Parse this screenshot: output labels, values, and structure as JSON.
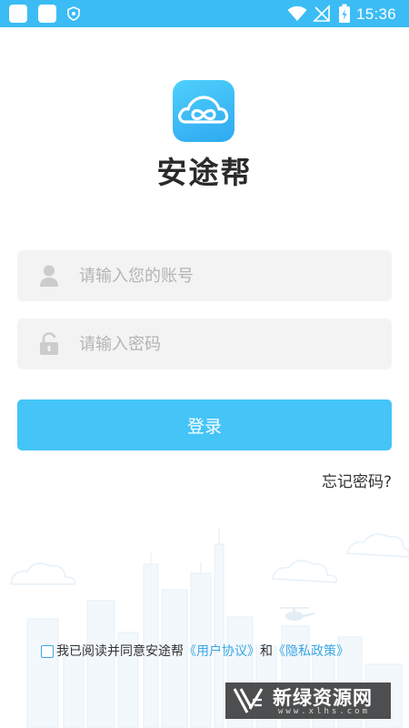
{
  "status_bar": {
    "time": "15:36",
    "icons": [
      "notification-icon",
      "notification-icon",
      "shield-icon",
      "wifi-icon",
      "no-signal-icon",
      "battery-charging-icon"
    ],
    "background": "#3bbcf5"
  },
  "app": {
    "name": "安途帮",
    "logo_icon": "infinity-cloud-logo-icon",
    "logo_color": "#36b5f5"
  },
  "login_form": {
    "account": {
      "placeholder": "请输入您的账号",
      "value": "",
      "icon": "user-icon"
    },
    "password": {
      "placeholder": "请输入密码",
      "value": "",
      "icon": "lock-icon"
    },
    "login_label": "登录",
    "login_color": "#45c4f7",
    "forgot_label": "忘记密码?"
  },
  "agreement": {
    "checked": false,
    "text_prefix": "我已阅读并同意安途帮",
    "user_agreement_label": "《用户协议》",
    "conjunction": "和",
    "privacy_policy_label": "《隐私政策》",
    "link_color": "#3aa6e6"
  },
  "watermark": {
    "title": "新绿资源网",
    "url": "www.xlhs.com"
  }
}
